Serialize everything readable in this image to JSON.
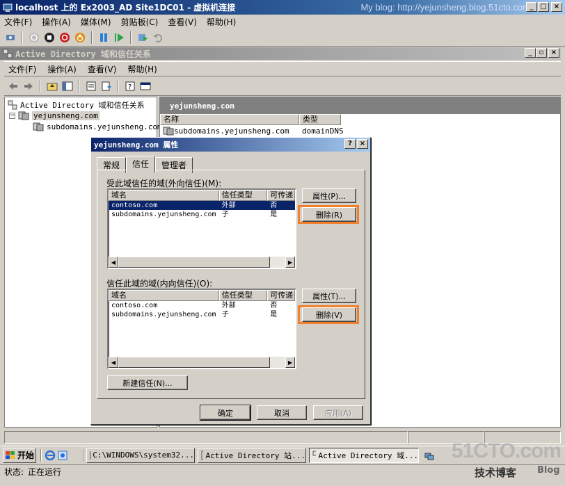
{
  "vm_window": {
    "title": "localhost 上的 Ex2003_AD Site1DC01 - 虚拟机连接",
    "blog_text": "My blog: http://yejunsheng.blog.51cto.com",
    "menu": [
      "文件(F)",
      "操作(A)",
      "媒体(M)",
      "剪贴板(C)",
      "查看(V)",
      "帮助(H)"
    ],
    "status_label": "状态:",
    "status_value": "正在运行"
  },
  "ad_window": {
    "title": "Active Directory 域和信任关系",
    "menu": [
      "文件(F)",
      "操作(A)",
      "查看(V)",
      "帮助(H)"
    ],
    "tree": {
      "root": "Active Directory 域和信任关系",
      "domain": "yejunsheng.com",
      "child": "subdomains.yejunsheng.com"
    },
    "list": {
      "header": "yejunsheng.com",
      "columns": [
        "名称",
        "类型"
      ],
      "rows": [
        {
          "name": "subdomains.yejunsheng.com",
          "type": "domainDNS"
        }
      ]
    }
  },
  "dialog": {
    "title": "yejunsheng.com 属性",
    "tabs": [
      "常规",
      "信任",
      "管理者"
    ],
    "active_tab": "信任",
    "outgoing": {
      "label": "受此域信任的域(外向信任)(M):",
      "columns": [
        "域名",
        "信任类型",
        "可传递"
      ],
      "rows": [
        {
          "domain": "contoso.com",
          "type": "外部",
          "transitive": "否",
          "selected": true
        },
        {
          "domain": "subdomains.yejunsheng.com",
          "type": "子",
          "transitive": "是",
          "selected": false
        }
      ],
      "properties_button": "属性(P)...",
      "remove_button": "删除(R)"
    },
    "incoming": {
      "label": "信任此域的域(内向信任)(O):",
      "columns": [
        "域名",
        "信任类型",
        "可传递"
      ],
      "rows": [
        {
          "domain": "contoso.com",
          "type": "外部",
          "transitive": "否"
        },
        {
          "domain": "subdomains.yejunsheng.com",
          "type": "子",
          "transitive": "是"
        }
      ],
      "properties_button": "属性(T)...",
      "remove_button": "删除(V)"
    },
    "new_trust_button": "新建信任(N)...",
    "ok_button": "确定",
    "cancel_button": "取消",
    "apply_button": "应用(A)",
    "help_button": "?",
    "close_button": "×"
  },
  "taskbar": {
    "start_label": "开始",
    "tasks": [
      "C:\\WINDOWS\\system32...",
      "Active Directory 站...",
      "Active Directory 域..."
    ]
  },
  "watermark": {
    "brand": "51CTO.com",
    "sub": "技术博客",
    "blog": "Blog"
  },
  "colors": {
    "titlebar": "#0a246a",
    "highlight_border": "#f07f2e",
    "selection": "#0a246a"
  }
}
